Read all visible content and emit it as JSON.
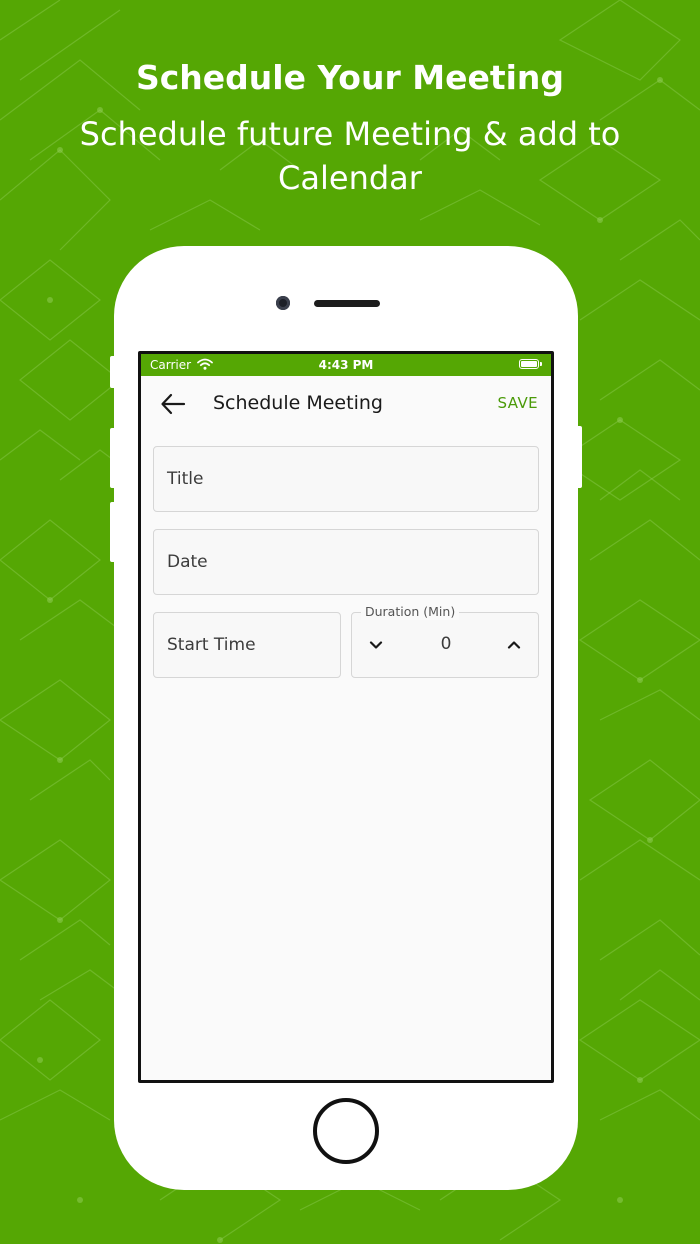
{
  "promo": {
    "headline": "Schedule Your Meeting",
    "subline": "Schedule future Meeting & add to Calendar"
  },
  "status_bar": {
    "carrier": "Carrier",
    "time": "4:43 PM",
    "wifi_icon": "wifi-icon",
    "battery_icon": "battery-icon"
  },
  "app_bar": {
    "back_icon": "arrow-left-icon",
    "title": "Schedule Meeting",
    "save_label": "SAVE"
  },
  "form": {
    "title_placeholder": "Title",
    "date_placeholder": "Date",
    "start_time_placeholder": "Start Time",
    "duration": {
      "label": "Duration (Min)",
      "value": "0",
      "decrement_icon": "chevron-down-icon",
      "increment_icon": "chevron-up-icon"
    }
  },
  "colors": {
    "brand_green": "#55a704",
    "save_green": "#4a9a08",
    "screen_bg": "#fafafa",
    "field_border": "#d6d6d6"
  }
}
